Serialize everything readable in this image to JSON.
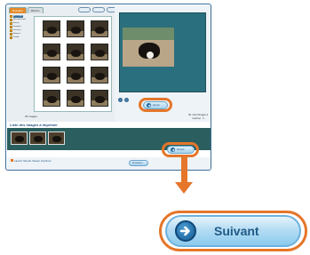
{
  "app": {
    "tabs": [
      {
        "label": "Dossiers"
      },
      {
        "label": "Albums"
      }
    ],
    "tree": [
      {
        "label": "Mes images"
      },
      {
        "label": "Mes documents"
      },
      {
        "label": "Bureau"
      },
      {
        "label": "Exemples"
      },
      {
        "label": "Vacances"
      },
      {
        "label": "Animaux"
      },
      {
        "label": "Famille"
      }
    ],
    "image_count": "20 images",
    "preview_button": "Ajouter",
    "right_note": "Nb. total d'images à imprimer : 3",
    "list_title": "Liste des images à imprimer",
    "next_button_small": "Suivant",
    "footer_label": "Lancer Simple Viewer imprimer",
    "footer_button": "Précédent"
  },
  "callout": {
    "next_button_label": "Suivant",
    "highlight_color": "#e5762a",
    "button_color": "#8ccbee",
    "icon": "arrow-right-icon"
  }
}
